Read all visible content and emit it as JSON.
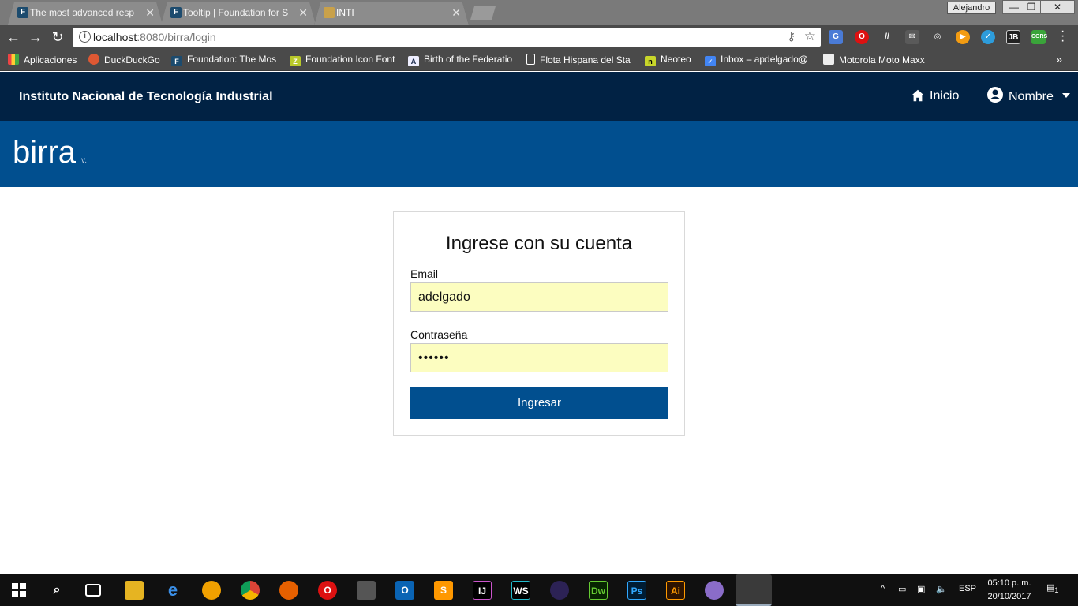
{
  "browser": {
    "tabs": [
      {
        "title": "The most advanced resp",
        "favicon": "F",
        "active": false
      },
      {
        "title": "Tooltip | Foundation for S",
        "favicon": "F",
        "active": false
      },
      {
        "title": "INTI",
        "favicon": "",
        "active": true
      }
    ],
    "user": "Alejandro",
    "url_host": "localhost",
    "url_path": ":8080/birra/login",
    "bookmarks": [
      {
        "label": "Aplicaciones"
      },
      {
        "label": "DuckDuckGo"
      },
      {
        "label": "Foundation: The Mos"
      },
      {
        "label": "Foundation Icon Font"
      },
      {
        "label": "Birth of the Federatio"
      },
      {
        "label": "Flota Hispana del Sta"
      },
      {
        "label": "Neoteo"
      },
      {
        "label": "Inbox – apdelgado@"
      },
      {
        "label": "Motorola Moto Maxx"
      }
    ],
    "ext_labels": {
      "jb": "JB",
      "cors": "CORS"
    }
  },
  "header": {
    "org_name": "Instituto Nacional de Tecnología Industrial",
    "nav_home": "Inicio",
    "nav_user": "Nombre",
    "brand": "birra",
    "version": "v."
  },
  "login": {
    "title": "Ingrese con su cuenta",
    "email_label": "Email",
    "email_value": "adelgado",
    "password_label": "Contraseña",
    "password_value": "••••••",
    "submit_label": "Ingresar"
  },
  "taskbar": {
    "language": "ESP",
    "time": "05:10 p. m.",
    "date": "20/10/2017",
    "notifications": "1",
    "app_labels": {
      "ij": "IJ",
      "ws": "WS",
      "dw": "Dw",
      "ps": "Ps",
      "ai": "Ai"
    }
  },
  "colors": {
    "header_dark": "#012244",
    "header_blue": "#014f8f",
    "button": "#014f8f",
    "autofill": "#fcfdc0"
  }
}
